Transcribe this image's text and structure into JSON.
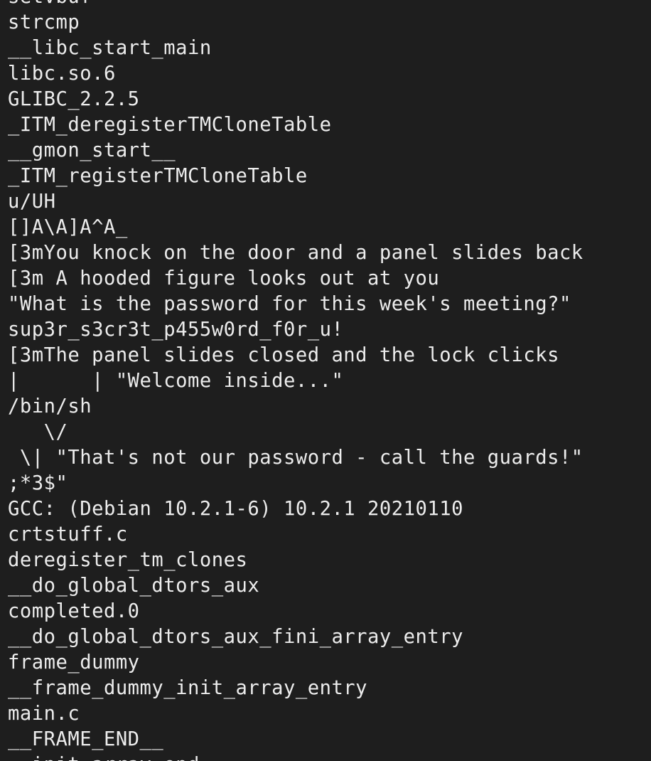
{
  "terminal": {
    "lines": [
      "setvbuf",
      "strcmp",
      "__libc_start_main",
      "libc.so.6",
      "GLIBC_2.2.5",
      "_ITM_deregisterTMCloneTable",
      "__gmon_start__",
      "_ITM_registerTMCloneTable",
      "u/UH",
      "[]A\\A]A^A_",
      "[3mYou knock on the door and a panel slides back",
      "[3m A hooded figure looks out at you",
      "\"What is the password for this week's meeting?\"",
      "sup3r_s3cr3t_p455w0rd_f0r_u!",
      "[3mThe panel slides closed and the lock clicks",
      "|      | \"Welcome inside...\"",
      "/bin/sh",
      "   \\/",
      " \\| \"That's not our password - call the guards!\"",
      ";*3$\"",
      "GCC: (Debian 10.2.1-6) 10.2.1 20210110",
      "crtstuff.c",
      "deregister_tm_clones",
      "__do_global_dtors_aux",
      "completed.0",
      "__do_global_dtors_aux_fini_array_entry",
      "frame_dummy",
      "__frame_dummy_init_array_entry",
      "main.c",
      "__FRAME_END__",
      "__init_array_end"
    ]
  },
  "colors": {
    "background": "#1e1e1e",
    "text": "#ececec"
  }
}
